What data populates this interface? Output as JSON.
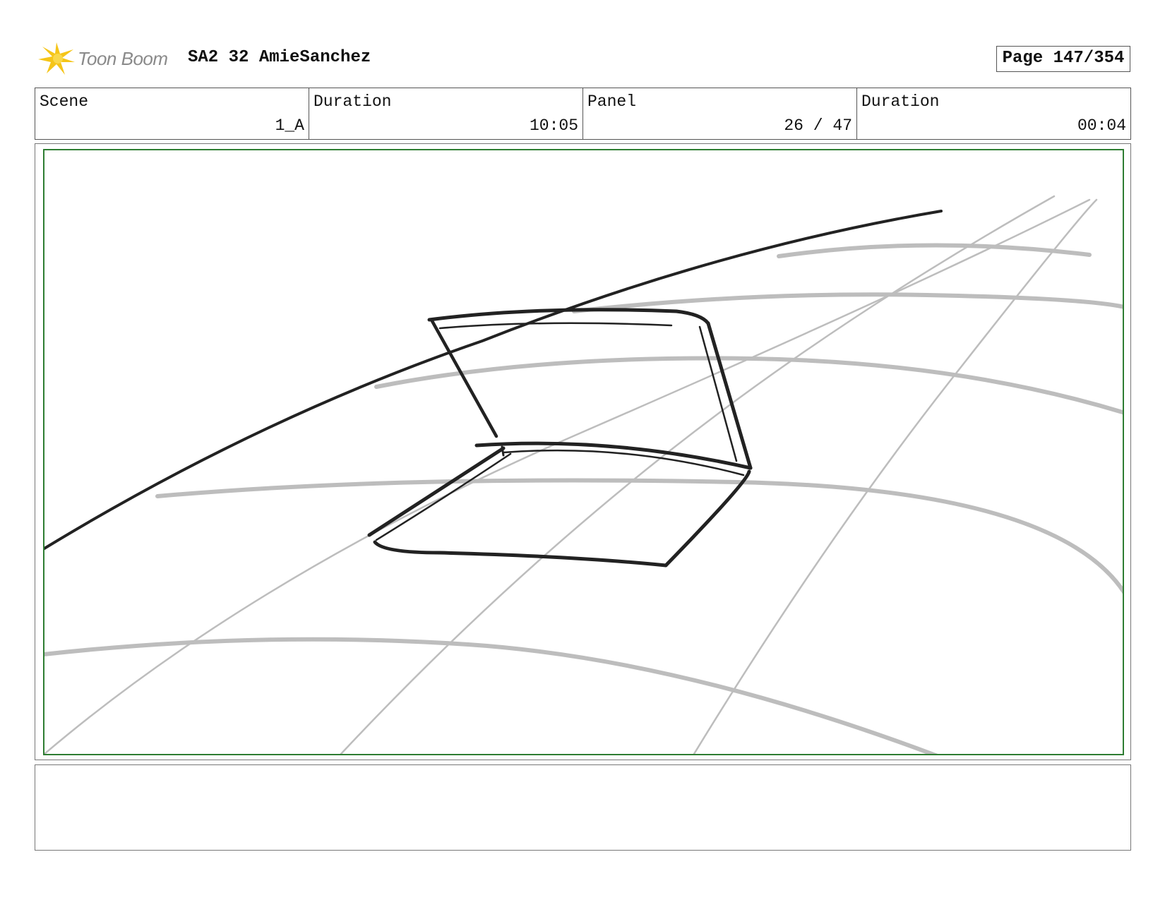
{
  "header": {
    "logo_text": "Toon Boom",
    "title": "SA2 32 AmieSanchez",
    "page_label": "Page 147/354"
  },
  "info": {
    "scene_label": "Scene",
    "scene_value": "1_A",
    "scene_duration_label": "Duration",
    "scene_duration_value": "10:05",
    "panel_label": "Panel",
    "panel_value": "26 / 47",
    "panel_duration_label": "Duration",
    "panel_duration_value": "00:04"
  },
  "colors": {
    "frame_border": "#2e7d32",
    "logo_star": "#f5c518",
    "sketch_dark": "#222222",
    "sketch_light": "#bdbdbd"
  },
  "icons": {
    "logo": "toon-boom-star-icon"
  },
  "notes": {
    "text": ""
  }
}
